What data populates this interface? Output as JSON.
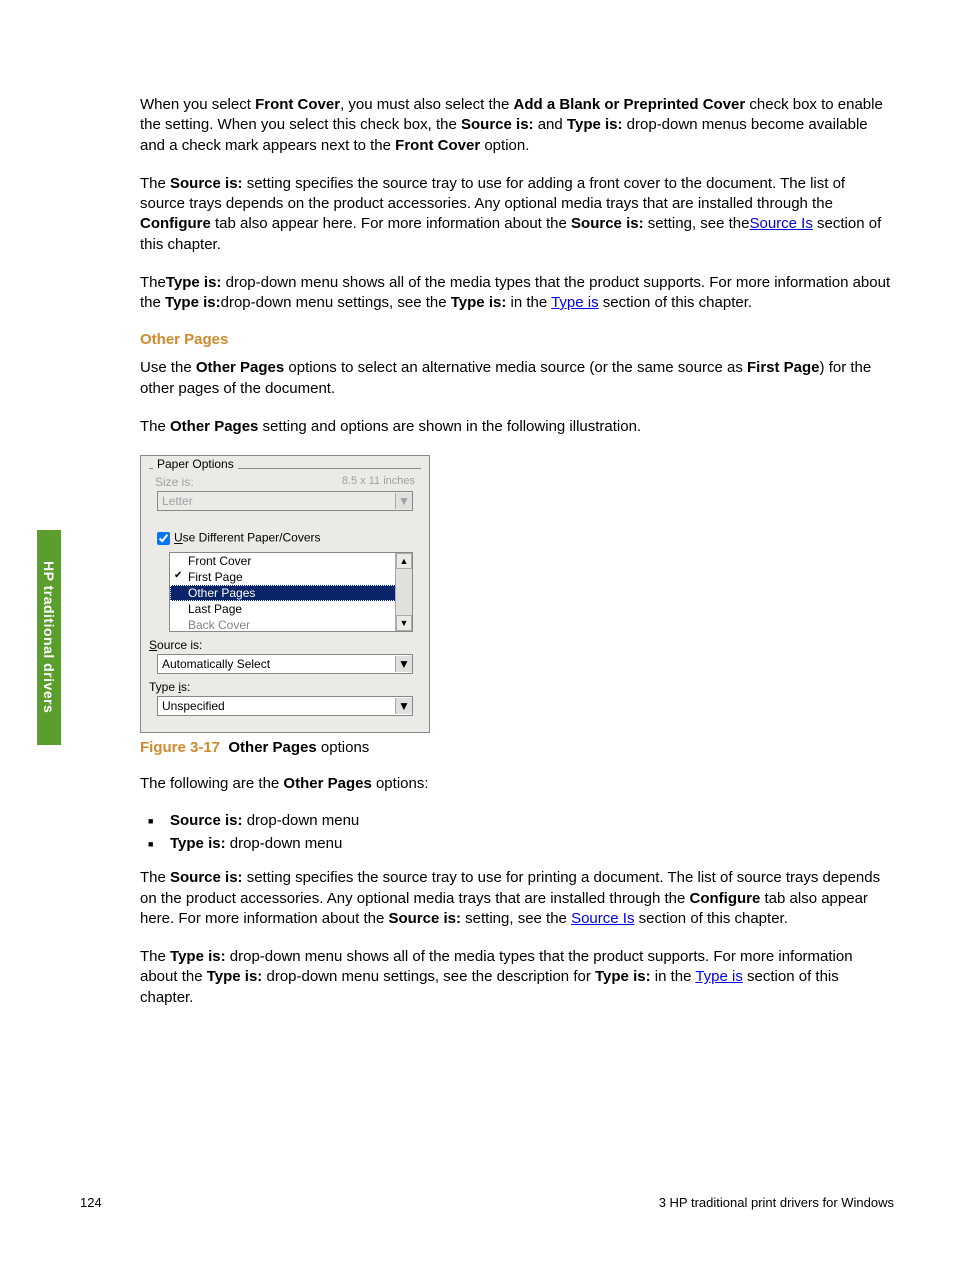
{
  "sideTab": "HP traditional drivers",
  "para1": {
    "t1": "When you select ",
    "b1": "Front Cover",
    "t2": ", you must also select the ",
    "b2": "Add a Blank or Preprinted Cover",
    "t3": " check box to enable the setting. When you select this check box, the ",
    "b3": "Source is:",
    "t4": " and ",
    "b4": "Type is:",
    "t5": " drop-down menus become available and a check mark appears next to the ",
    "b5": "Front Cover",
    "t6": " option."
  },
  "para2": {
    "t1": "The ",
    "b1": "Source is:",
    "t2": " setting specifies the source tray to use for adding a front cover to the document. The list of source trays depends on the product accessories. Any optional media trays that are installed through the ",
    "b2": "Configure",
    "t3": " tab also appear here. For more information about the ",
    "b3": "Source is:",
    "t4": " setting, see the",
    "link": "Source Is",
    "t5": " section of this chapter."
  },
  "para3": {
    "t1": "The",
    "b1": "Type is:",
    "t2": " drop-down menu shows all of the media types that the product supports. For more information about the ",
    "b2": "Type is:",
    "t3": "drop-down menu settings, see the ",
    "b3": "Type is:",
    "t4": " in the ",
    "link": "Type is",
    "t5": " section of this chapter."
  },
  "headingOtherPages": "Other Pages",
  "para4": {
    "t1": "Use the ",
    "b1": "Other Pages",
    "t2": " options to select an alternative media source (or the same source as ",
    "b2": "First Page",
    "t3": ") for the other pages of the document."
  },
  "para5": {
    "t1": "The ",
    "b1": "Other Pages",
    "t2": " setting and options are shown in the following illustration."
  },
  "dialog": {
    "groupLabel": "Paper Options",
    "sizeLabel": "Size is:",
    "sizeHint": "8.5 x 11 inches",
    "sizeValue": "Letter",
    "useDiffPre": "U",
    "useDiffRest": "se Different Paper/Covers",
    "items": {
      "frontCover": "Front Cover",
      "firstPage": "First Page",
      "otherPages": "Other Pages",
      "lastPage": "Last Page",
      "backCover": "Back Cover"
    },
    "sourcePre": "S",
    "sourceRest": "ource is:",
    "sourceValue": "Automatically Select",
    "typePre": "Type ",
    "typeUnder": "i",
    "typeRest2": "s:",
    "typeValue": "Unspecified"
  },
  "figCaption": {
    "num": "Figure 3-17",
    "bold": "Other Pages",
    "rest": " options"
  },
  "para6": {
    "t1": "The following are the ",
    "b1": "Other Pages",
    "t2": " options:"
  },
  "bullets": {
    "b1a": "Source is:",
    "b1b": " drop-down menu",
    "b2a": "Type is:",
    "b2b": " drop-down menu"
  },
  "para7": {
    "t1": "The ",
    "b1": "Source is:",
    "t2": " setting specifies the source tray to use for printing a document. The list of source trays depends on the product accessories. Any optional media trays that are installed through the ",
    "b2": "Configure",
    "t3": " tab also appear here. For more information about the ",
    "b3": "Source is:",
    "t4": " setting, see the ",
    "link": "Source Is",
    "t5": " section of this chapter."
  },
  "para8": {
    "t1": "The ",
    "b1": "Type is:",
    "t2": " drop-down menu shows all of the media types that the product supports. For more information about the ",
    "b2": "Type is:",
    "t3": " drop-down menu settings, see the description for ",
    "b3": "Type is:",
    "t4": " in the ",
    "link": "Type is",
    "t5": " section of this chapter."
  },
  "footer": {
    "pageNum": "124",
    "chapter": "3   HP traditional print drivers for Windows"
  }
}
